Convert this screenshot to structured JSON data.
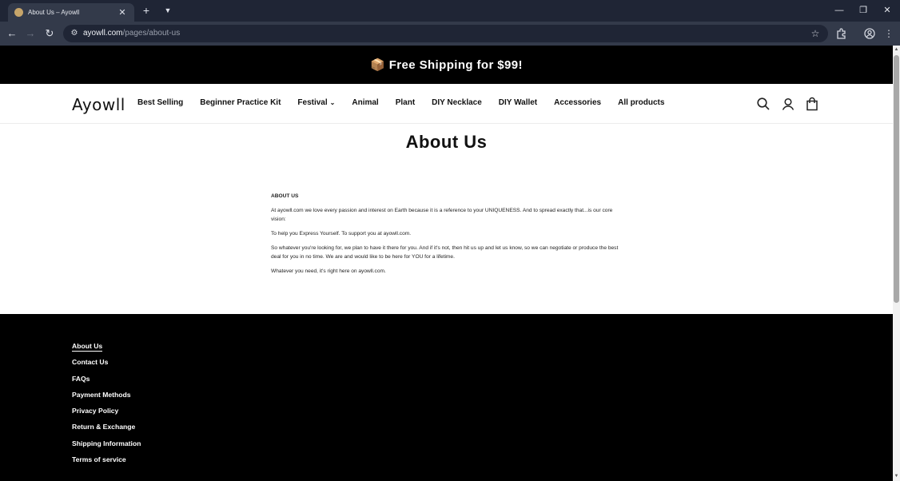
{
  "browser": {
    "tab_title": "About Us – Ayowll",
    "url_host": "ayowll.com",
    "url_path": "/pages/about-us",
    "icons": [
      "close-icon",
      "plus-icon",
      "chevron-down-icon",
      "minimize-icon",
      "restore-icon",
      "back-icon",
      "forward-icon",
      "reload-icon",
      "site-settings-icon",
      "star-icon",
      "extensions-icon",
      "profile-icon",
      "menu-icon"
    ]
  },
  "announcement": {
    "text": "📦 Free Shipping for $99!"
  },
  "header": {
    "logo": "Ayowll",
    "menu": [
      {
        "label": "Best Selling"
      },
      {
        "label": "Beginner Practice Kit"
      },
      {
        "label": "Festival",
        "dropdown": true
      },
      {
        "label": "Animal"
      },
      {
        "label": "Plant"
      },
      {
        "label": "DIY Necklace"
      },
      {
        "label": "DIY Wallet"
      },
      {
        "label": "Accessories"
      },
      {
        "label": "All products"
      }
    ],
    "icons": [
      "search-icon",
      "account-icon",
      "cart-icon"
    ]
  },
  "main": {
    "title": "About Us",
    "heading": "ABOUT US",
    "paragraphs": [
      "At ayowll.com  we love every passion and interest on Earth because it is a reference to your UNIQUENESS. And to spread exactly that...is our core vision:",
      "To help you Express Yourself. To support you at ayowll.com.",
      "So whatever you're looking for, we plan to have it there for you. And if it's not, then hit us up and let us know, so we can negotiate or produce the best deal for you in no time. We are and would like to be here for YOU for a lifetime.",
      "Whatever you need, it's right here on ayowll.com."
    ]
  },
  "footer": {
    "links": [
      "About Us",
      "Contact Us",
      "FAQs",
      "Payment Methods",
      "Privacy Policy",
      "Return & Exchange",
      "Shipping Information",
      "Terms of service"
    ]
  },
  "colors": {
    "announcement_bg": "#000000",
    "footer_bg": "#000000",
    "chrome_dark": "#1f2535",
    "chrome_toolbar": "#333a4a"
  }
}
